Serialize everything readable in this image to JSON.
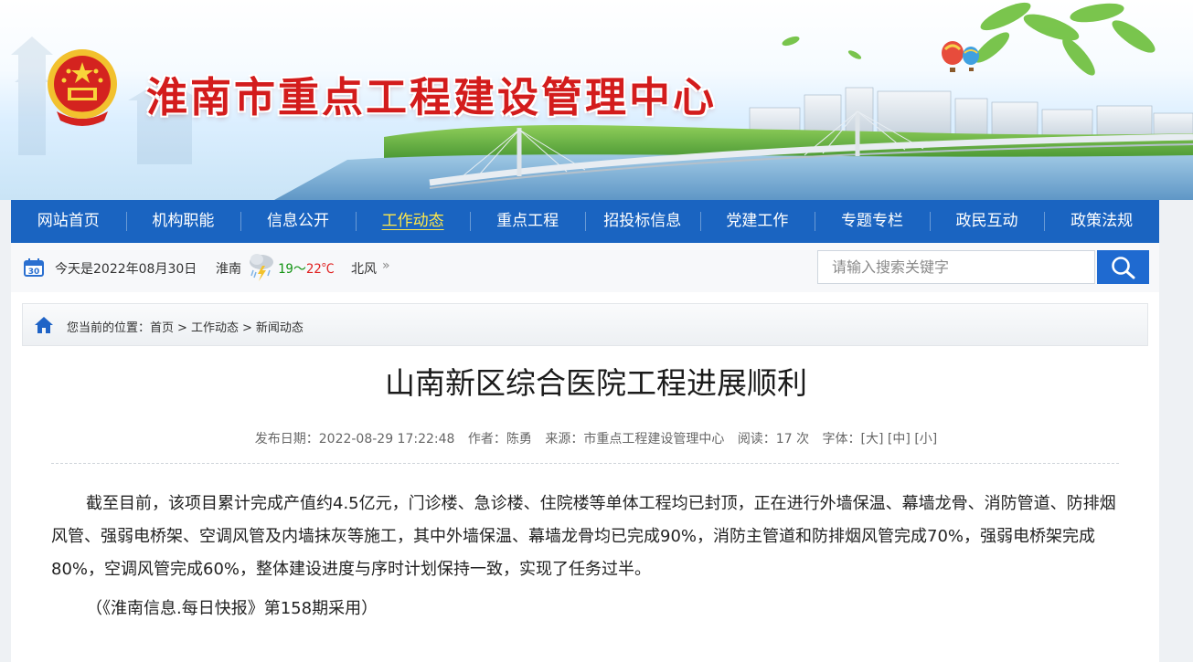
{
  "header": {
    "site_title": "淮南市重点工程建设管理中心"
  },
  "nav": {
    "items": [
      {
        "label": "网站首页"
      },
      {
        "label": "机构职能"
      },
      {
        "label": "信息公开"
      },
      {
        "label": "工作动态",
        "active": true
      },
      {
        "label": "重点工程"
      },
      {
        "label": "招投标信息"
      },
      {
        "label": "党建工作"
      },
      {
        "label": "专题专栏"
      },
      {
        "label": "政民互动"
      },
      {
        "label": "政策法规"
      }
    ],
    "active_color": "#ffe84a",
    "bar_color": "#1a64c1"
  },
  "infobar": {
    "calendar_icon_day": "30",
    "date_text": "今天是2022年08月30日",
    "city": "淮南",
    "weather_icon": "thunderstorm-icon",
    "temp_low": "19",
    "temp_sep": "～",
    "temp_high": "22℃",
    "wind": "北风",
    "more_glyph": "»",
    "search_placeholder": "请输入搜索关键字"
  },
  "breadcrumb": {
    "prefix": "您当前的位置：",
    "items": [
      "首页",
      "工作动态",
      "新闻动态"
    ],
    "separator": ">"
  },
  "article": {
    "title": "山南新区综合医院工程进展顺利",
    "meta": {
      "publish": "发布日期：2022-08-29 17:22:48",
      "author": "作者：陈勇",
      "source": "来源：市重点工程建设管理中心",
      "reads": "阅读：17 次",
      "font_label": "字体：",
      "font_large": "[大]",
      "font_medium": "[中]",
      "font_small": "[小]"
    },
    "paragraph": "截至目前，该项目累计完成产值约4.5亿元，门诊楼、急诊楼、住院楼等单体工程均已封顶，正在进行外墙保温、幕墙龙骨、消防管道、防排烟风管、强弱电桥架、空调风管及内墙抹灰等施工，其中外墙保温、幕墙龙骨均已完成90%，消防主管道和防排烟风管完成70%，强弱电桥架完成80%，空调风管完成60%，整体建设进度与序时计划保持一致，实现了任务过半。",
    "source_note": "（《淮南信息.每日快报》第158期采用）"
  }
}
